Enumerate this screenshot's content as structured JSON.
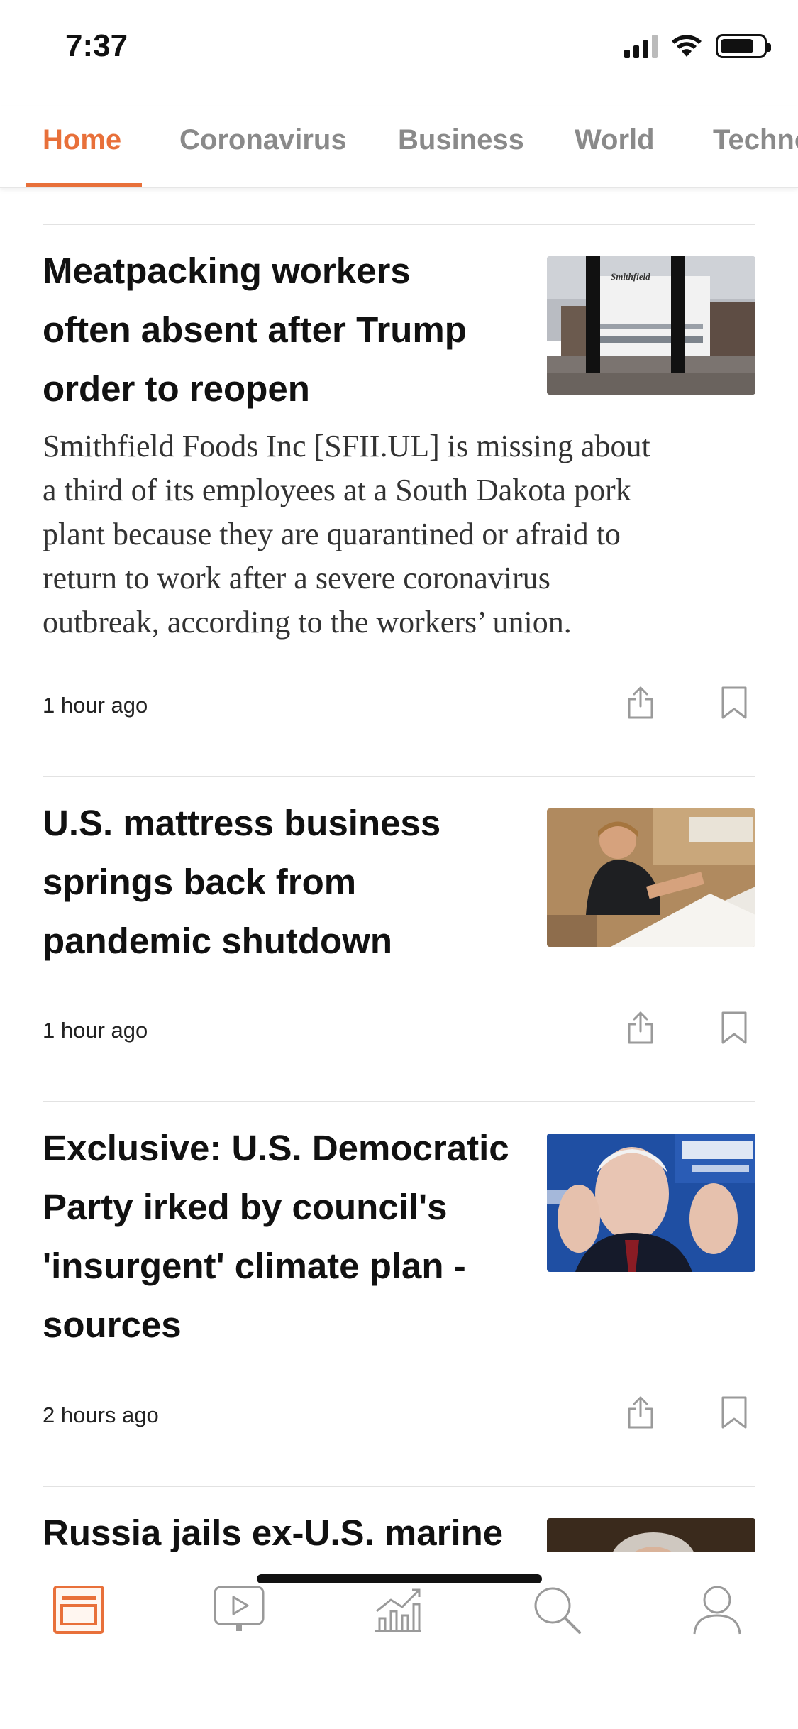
{
  "status_bar": {
    "time": "7:37",
    "icons": [
      "signal-icon",
      "wifi-icon",
      "battery-icon"
    ],
    "battery_level": 0.8
  },
  "tabs": [
    {
      "label": "Home",
      "active": true
    },
    {
      "label": "Coronavirus",
      "active": false
    },
    {
      "label": "Business",
      "active": false
    },
    {
      "label": "World",
      "active": false
    },
    {
      "label": "Techno",
      "active": false
    }
  ],
  "colors": {
    "accent": "#e8703a",
    "tab_inactive": "#8a8a8a",
    "icon_gray": "#9a9a9a"
  },
  "articles": [
    {
      "headline_lines": [
        "Meatpacking workers",
        "often absent after Trump",
        "order to reopen"
      ],
      "summary_lines": [
        "Smithfield Foods Inc [SFII.UL] is missing about",
        "a third of its employees at a South Dakota pork",
        "plant because they are quarantined or afraid to",
        "return to work after a severe coronavirus",
        "outbreak, according to the workers’ union."
      ],
      "time": "1 hour ago",
      "image": "smithfield-plant-photo",
      "image_sign_text": "Smithfield"
    },
    {
      "headline_lines": [
        "U.S. mattress business",
        "springs back from",
        "pandemic shutdown"
      ],
      "time": "1 hour ago",
      "image": "mattress-worker-photo"
    },
    {
      "headline_lines": [
        "Exclusive: U.S. Democratic",
        "Party irked by council's",
        "'insurgent' climate plan -",
        "sources"
      ],
      "time": "2 hours ago",
      "image": "biden-press-photo"
    },
    {
      "headline_lines": [
        "Russia jails ex-U.S. marine"
      ],
      "image": "court-photo"
    }
  ],
  "bottom_nav": [
    {
      "icon": "news-feed-icon",
      "active": true
    },
    {
      "icon": "video-icon",
      "active": false
    },
    {
      "icon": "markets-chart-icon",
      "active": false
    },
    {
      "icon": "search-icon",
      "active": false
    },
    {
      "icon": "profile-icon",
      "active": false
    }
  ]
}
